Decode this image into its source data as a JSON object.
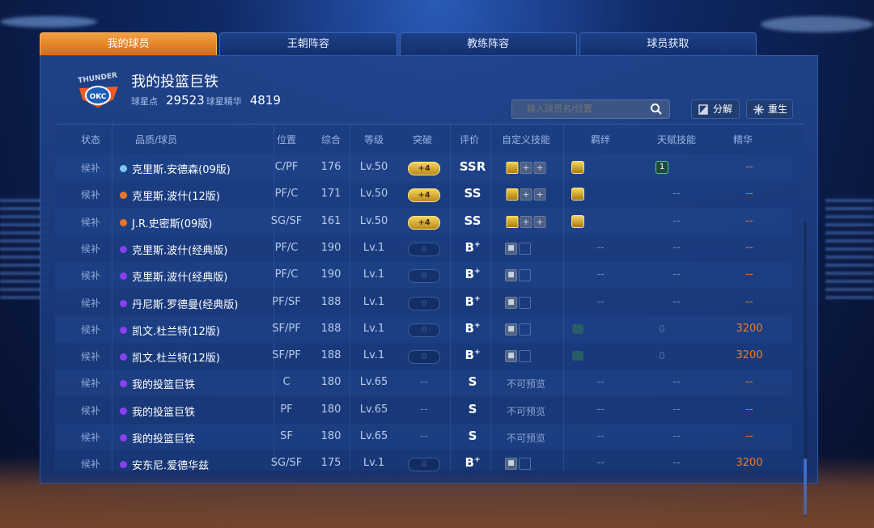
{
  "tabs": [
    {
      "label": "我的球员",
      "active": true
    },
    {
      "label": "王朝阵容",
      "active": false
    },
    {
      "label": "教练阵容",
      "active": false
    },
    {
      "label": "球员获取",
      "active": false
    }
  ],
  "header": {
    "logo_text": "THUNDER",
    "logo_badge": "OKC",
    "title": "我的投篮巨铁",
    "star_points_label": "球星点",
    "star_points_value": "29523",
    "essence_label": "球星精华",
    "essence_value": "4819"
  },
  "search": {
    "placeholder": "输入球员名/位置",
    "icon": "search-icon"
  },
  "actions": {
    "decompose_label": "分解",
    "rebirth_label": "重生"
  },
  "columns": [
    "状态",
    "品质/球员",
    "位置",
    "综合",
    "等级",
    "突破",
    "评价",
    "自定义技能",
    "羁绊",
    "天赋技能",
    "精华"
  ],
  "colors": {
    "accent_orange": "#e2791f",
    "quality_blue": "#7fc3ee",
    "quality_orange": "#e8772b",
    "quality_purple": "#8a3ff0",
    "essence": "#f07a2a"
  },
  "rows": [
    {
      "state": "候补",
      "quality": "blue",
      "name": "克里斯.安德森(09版)",
      "pos": "C/PF",
      "ovr": "176",
      "lvl": "Lv.50",
      "breakthrough": "+4",
      "grade": "SSR",
      "skills": "gold-plus",
      "bond": "gold",
      "talent": "1",
      "essence": "--"
    },
    {
      "state": "候补",
      "quality": "orange",
      "name": "克里斯.波什(12版)",
      "pos": "PF/C",
      "ovr": "171",
      "lvl": "Lv.50",
      "breakthrough": "+4",
      "grade": "SS",
      "skills": "gold-plus",
      "bond": "gold",
      "talent": "--",
      "essence": "--"
    },
    {
      "state": "候补",
      "quality": "orange",
      "name": "J.R.史密斯(09版)",
      "pos": "SG/SF",
      "ovr": "161",
      "lvl": "Lv.50",
      "breakthrough": "+4",
      "grade": "SS",
      "skills": "gold-plus",
      "bond": "gold",
      "talent": "--",
      "essence": "--"
    },
    {
      "state": "候补",
      "quality": "purple",
      "name": "克里斯.波什(经典版)",
      "pos": "PF/C",
      "ovr": "190",
      "lvl": "Lv.1",
      "breakthrough": "0",
      "grade": "B+",
      "skills": "lock",
      "bond": "--",
      "talent": "--",
      "essence": "--"
    },
    {
      "state": "候补",
      "quality": "purple",
      "name": "克里斯.波什(经典版)",
      "pos": "PF/C",
      "ovr": "190",
      "lvl": "Lv.1",
      "breakthrough": "0",
      "grade": "B+",
      "skills": "lock",
      "bond": "--",
      "talent": "--",
      "essence": "--"
    },
    {
      "state": "候补",
      "quality": "purple",
      "name": "丹尼斯.罗德曼(经典版)",
      "pos": "PF/SF",
      "ovr": "188",
      "lvl": "Lv.1",
      "breakthrough": "0",
      "grade": "B+",
      "skills": "lock",
      "bond": "--",
      "talent": "--",
      "essence": "--"
    },
    {
      "state": "候补",
      "quality": "purple",
      "name": "凯文.杜兰特(12版)",
      "pos": "SF/PF",
      "ovr": "188",
      "lvl": "Lv.1",
      "breakthrough": "0",
      "grade": "B+",
      "skills": "lock",
      "bond": "dim",
      "talent": "0",
      "essence": "3200"
    },
    {
      "state": "候补",
      "quality": "purple",
      "name": "凯文.杜兰特(12版)",
      "pos": "SF/PF",
      "ovr": "188",
      "lvl": "Lv.1",
      "breakthrough": "0",
      "grade": "B+",
      "skills": "lock",
      "bond": "dim",
      "talent": "0",
      "essence": "3200"
    },
    {
      "state": "候补",
      "quality": "purple",
      "name": "我的投篮巨铁",
      "pos": "C",
      "ovr": "180",
      "lvl": "Lv.65",
      "breakthrough": "--",
      "grade": "S",
      "skills": "不可预览",
      "bond": "--",
      "talent": "--",
      "essence": "--"
    },
    {
      "state": "候补",
      "quality": "purple",
      "name": "我的投篮巨铁",
      "pos": "PF",
      "ovr": "180",
      "lvl": "Lv.65",
      "breakthrough": "--",
      "grade": "S",
      "skills": "不可预览",
      "bond": "--",
      "talent": "--",
      "essence": "--"
    },
    {
      "state": "候补",
      "quality": "purple",
      "name": "我的投篮巨铁",
      "pos": "SF",
      "ovr": "180",
      "lvl": "Lv.65",
      "breakthrough": "--",
      "grade": "S",
      "skills": "不可预览",
      "bond": "--",
      "talent": "--",
      "essence": "--"
    },
    {
      "state": "候补",
      "quality": "purple",
      "name": "安东尼.爱德华兹",
      "pos": "SG/SF",
      "ovr": "175",
      "lvl": "Lv.1",
      "breakthrough": "0",
      "grade": "B+",
      "skills": "lock",
      "bond": "--",
      "talent": "--",
      "essence": "3200"
    }
  ]
}
